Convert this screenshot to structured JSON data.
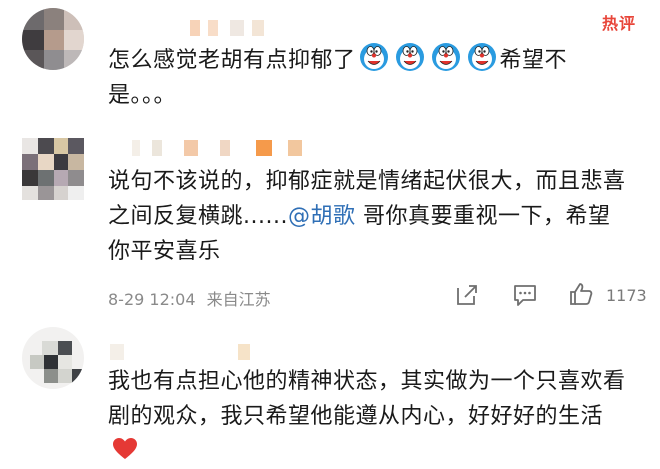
{
  "comments": [
    {
      "text": "怎么感觉老胡有点抑郁了",
      "emoji_count": 4,
      "text_after": "希望不是。。。",
      "badge": "热评",
      "emoji_icon": "doraemon-icon"
    },
    {
      "text_before": "说句不该说的，抑郁症就是情绪起伏很大，而且悲喜之间反复横跳......",
      "mention": "@胡歌",
      "text_after": " 哥你真要重视一下，希望你平安喜乐",
      "time": "8-29 12:04",
      "location": "来自江苏",
      "likes": "1173"
    },
    {
      "text": "我也有点担心他的精神状态，其实做为一个只喜欢看剧的观众，我只希望他能遵从内心，好好好的生活",
      "emoji_icon": "red-heart-icon"
    }
  ],
  "colors": {
    "mention": "#2f6fb6",
    "badge": "#e8463a",
    "meta": "#8a8a8a"
  }
}
